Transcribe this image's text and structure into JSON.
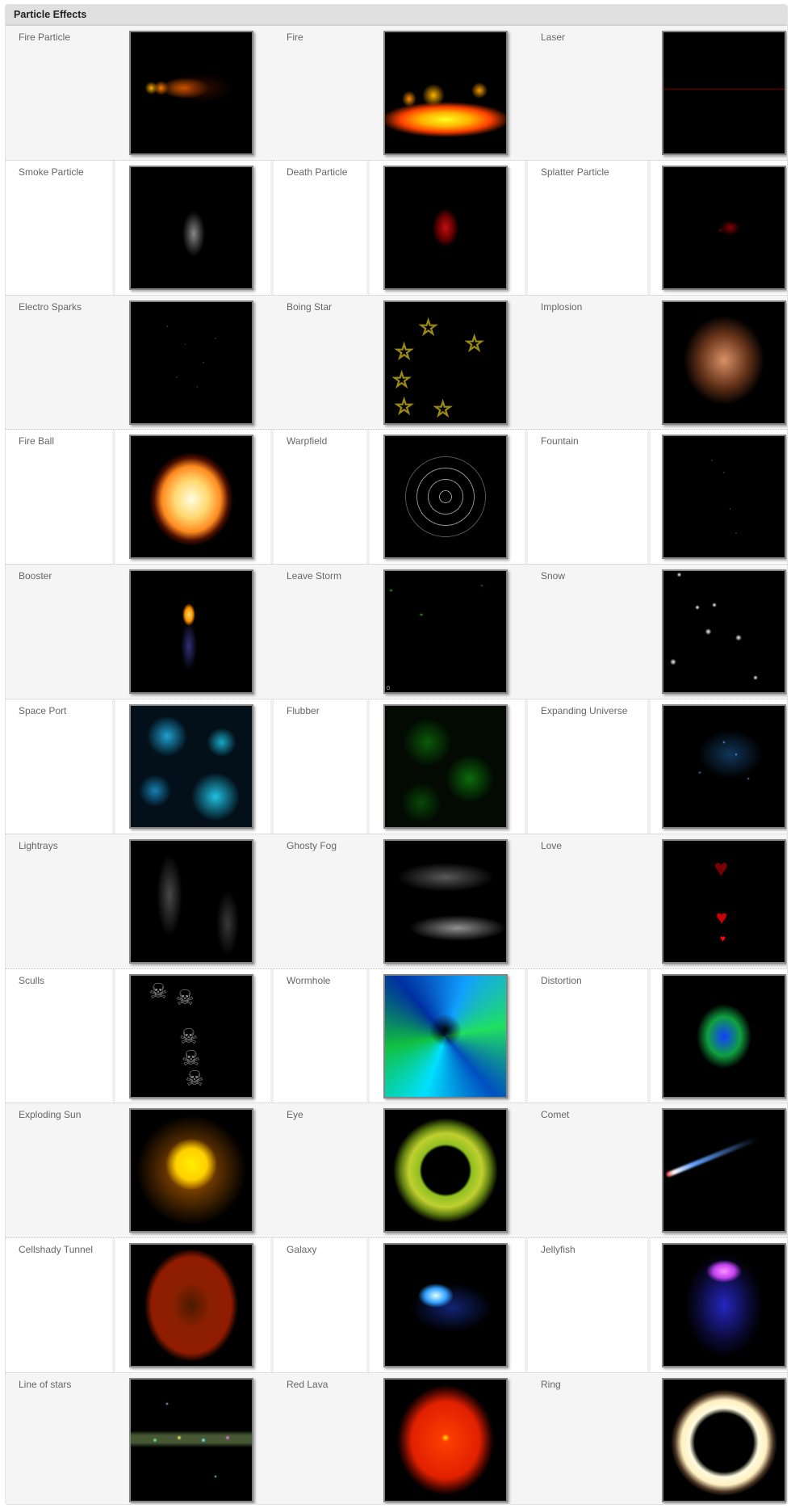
{
  "panel": {
    "title": "Particle Effects"
  },
  "rows": [
    {
      "cells": [
        {
          "label": "Fire Particle",
          "effect": "fire-particle"
        },
        {
          "label": "Fire",
          "effect": "fire"
        },
        {
          "label": "Laser",
          "effect": "laser"
        }
      ]
    },
    {
      "cells": [
        {
          "label": "Smoke Particle",
          "effect": "smoke"
        },
        {
          "label": "Death Particle",
          "effect": "death"
        },
        {
          "label": "Splatter Particle",
          "effect": "splatter"
        }
      ]
    },
    {
      "cells": [
        {
          "label": "Electro Sparks",
          "effect": "electro"
        },
        {
          "label": "Boing Star",
          "effect": "boing"
        },
        {
          "label": "Implosion",
          "effect": "implosion"
        }
      ]
    },
    {
      "cells": [
        {
          "label": "Fire Ball",
          "effect": "fireball"
        },
        {
          "label": "Warpfield",
          "effect": "warpfield"
        },
        {
          "label": "Fountain",
          "effect": "fountain"
        }
      ]
    },
    {
      "cells": [
        {
          "label": "Booster",
          "effect": "booster"
        },
        {
          "label": "Leave Storm",
          "effect": "leaves"
        },
        {
          "label": "Snow",
          "effect": "snow"
        }
      ]
    },
    {
      "cells": [
        {
          "label": "Space Port",
          "effect": "spaceport"
        },
        {
          "label": "Flubber",
          "effect": "flubber"
        },
        {
          "label": "Expanding Universe",
          "effect": "universe"
        }
      ]
    },
    {
      "cells": [
        {
          "label": "Lightrays",
          "effect": "lightrays"
        },
        {
          "label": "Ghosty Fog",
          "effect": "fog"
        },
        {
          "label": "Love",
          "effect": "love"
        }
      ]
    },
    {
      "cells": [
        {
          "label": "Sculls",
          "effect": "sculls"
        },
        {
          "label": "Wormhole",
          "effect": "wormhole"
        },
        {
          "label": "Distortion",
          "effect": "distortion"
        }
      ]
    },
    {
      "cells": [
        {
          "label": "Exploding Sun",
          "effect": "sun"
        },
        {
          "label": "Eye",
          "effect": "eye"
        },
        {
          "label": "Comet",
          "effect": "comet"
        }
      ]
    },
    {
      "cells": [
        {
          "label": "Cellshady Tunnel",
          "effect": "tunnel"
        },
        {
          "label": "Galaxy",
          "effect": "galaxy"
        },
        {
          "label": "Jellyfish",
          "effect": "jellyfish"
        }
      ]
    },
    {
      "cells": [
        {
          "label": "Line of stars",
          "effect": "stars"
        },
        {
          "label": "Red Lava",
          "effect": "lava"
        },
        {
          "label": "Ring",
          "effect": "ring"
        }
      ]
    }
  ],
  "extra_glyphs": {
    "leave_storm_counter": "0",
    "star_glyph": "☆",
    "heart_glyph": "♥",
    "skull_glyph": "☠"
  }
}
